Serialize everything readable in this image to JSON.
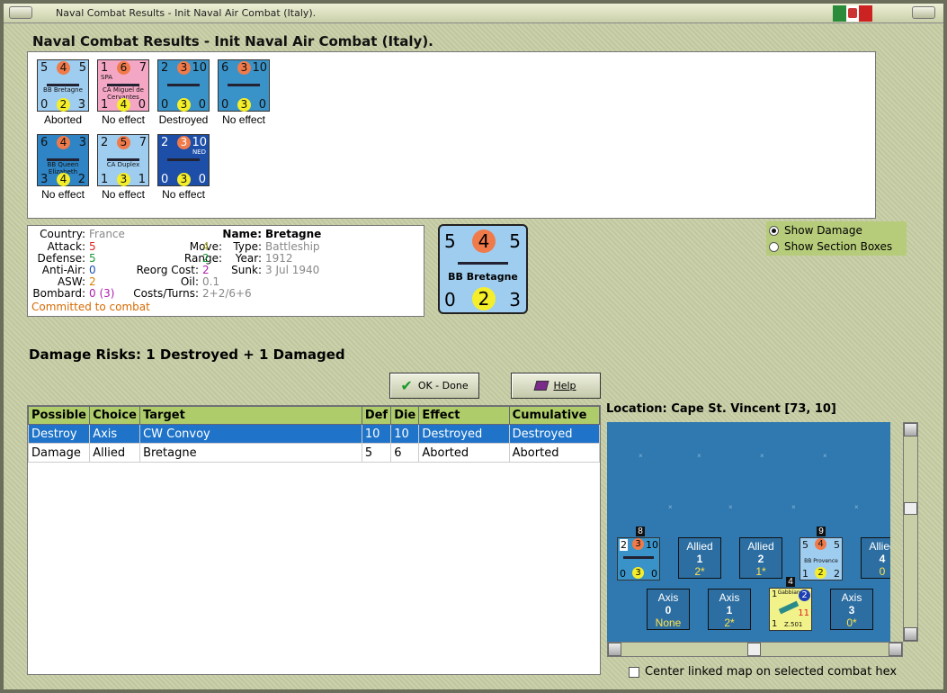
{
  "window": {
    "title": "Naval Combat Results - Init Naval Air Combat (Italy)."
  },
  "heading": "Naval Combat Results - Init Naval Air Combat (Italy).",
  "counters": [
    {
      "tl": "5",
      "tc": "4",
      "tr": "5",
      "name": "BB Bretagne",
      "bl": "0",
      "bc": "2",
      "br": "3",
      "result": "Aborted",
      "bg": "#9fcdf0"
    },
    {
      "tl": "1",
      "tc": "6",
      "tr": "7",
      "name": "CA Miguel de Cervantes",
      "tag": "SPA",
      "bl": "1",
      "bc": "4",
      "br": "0",
      "result": "No effect",
      "bg": "#f4a7c4"
    },
    {
      "tl": "2",
      "tc": "3",
      "tr": "10",
      "name": "",
      "bl": "0",
      "bc": "3",
      "br": "0",
      "result": "Destroyed",
      "bg": "#3a93c8"
    },
    {
      "tl": "6",
      "tc": "3",
      "tr": "10",
      "name": "",
      "bl": "0",
      "bc": "3",
      "br": "0",
      "result": "No effect",
      "bg": "#3a93c8"
    },
    {
      "tl": "6",
      "tc": "4",
      "tr": "3",
      "name": "BB Queen Elizabeth",
      "bl": "3",
      "bc": "4",
      "br": "2",
      "result": "No effect",
      "bg": "#2e84c4"
    },
    {
      "tl": "2",
      "tc": "5",
      "tr": "7",
      "name": "CA Duplex",
      "bl": "1",
      "bc": "3",
      "br": "1",
      "result": "No effect",
      "bg": "#9fcdf0"
    },
    {
      "tl": "2",
      "tc": "3",
      "tr": "10",
      "name": "",
      "tag": "NED",
      "bl": "0",
      "bc": "3",
      "br": "0",
      "result": "No effect",
      "bg": "#1d4fa8"
    }
  ],
  "info": {
    "country_label": "Country:",
    "country": "France",
    "attack_label": "Attack:",
    "attack": "5",
    "defense_label": "Defense:",
    "defense": "5",
    "antiair_label": "Anti-Air:",
    "antiair": "0",
    "asw_label": "ASW:",
    "asw": "2",
    "bombard_label": "Bombard:",
    "bombard": "0 (3)",
    "move_label": "Move:",
    "move": "4",
    "range_label": "Range:",
    "range": "2",
    "reorg_label": "Reorg Cost:",
    "reorg": "2",
    "oil_label": "Oil:",
    "oil": "0.1",
    "costs_label": "Costs/Turns:",
    "costs": "2+2/6+6",
    "name_label": "Name:",
    "name": "Bretagne",
    "type_label": "Type:",
    "type": "Battleship",
    "year_label": "Year:",
    "year": "1912",
    "sunk_label": "Sunk:",
    "sunk": "3 Jul 1940",
    "status": "Committed to combat"
  },
  "big_counter": {
    "tl": "5",
    "tc": "4",
    "tr": "5",
    "name": "BB Bretagne",
    "bl": "0",
    "bc": "2",
    "br": "3"
  },
  "options": {
    "show_damage": "Show Damage",
    "show_sections": "Show Section Boxes"
  },
  "damage_risks": "Damage Risks:  1 Destroyed + 1 Damaged",
  "buttons": {
    "ok": "OK - Done",
    "help": "Help"
  },
  "table": {
    "headers": [
      "Possible",
      "Choice",
      "Target",
      "Def",
      "Die",
      "Effect",
      "Cumulative"
    ],
    "rows": [
      [
        "Destroy",
        "Axis",
        "CW Convoy",
        "10",
        "10",
        "Destroyed",
        "Destroyed"
      ],
      [
        "Damage",
        "Allied",
        "Bretagne",
        "5",
        "6",
        "Aborted",
        "Aborted"
      ]
    ]
  },
  "location": "Location:  Cape St. Vincent [73, 10]",
  "map": {
    "allied_boxes": [
      {
        "side": "Allied",
        "num": "1",
        "sub": "2*"
      },
      {
        "side": "Allied",
        "num": "2",
        "sub": "1*"
      },
      {
        "side": "Allied",
        "num": "4",
        "sub": "0"
      }
    ],
    "axis_boxes": [
      {
        "side": "Axis",
        "num": "0",
        "sub": "None"
      },
      {
        "side": "Axis",
        "num": "1",
        "sub": "2*"
      },
      {
        "side": "Axis",
        "num": "3",
        "sub": "0*"
      }
    ],
    "stack_a": "8",
    "stack_b": "9",
    "stack_c": "4",
    "counter_a": {
      "tl": "2",
      "tc": "3",
      "tr": "10",
      "bl": "0",
      "bc": "3",
      "br": "0"
    },
    "counter_b": {
      "tl": "5",
      "tc": "4",
      "tr": "5",
      "name": "BB Provence",
      "bl": "1",
      "bc": "2",
      "br": "2"
    },
    "counter_c": {
      "tl": "1",
      "tc": "2",
      "name": "Gabbiano",
      "mid": "11",
      "bl": "1",
      "br": "Z.501"
    }
  },
  "center_map_label": "Center linked map on selected combat hex"
}
